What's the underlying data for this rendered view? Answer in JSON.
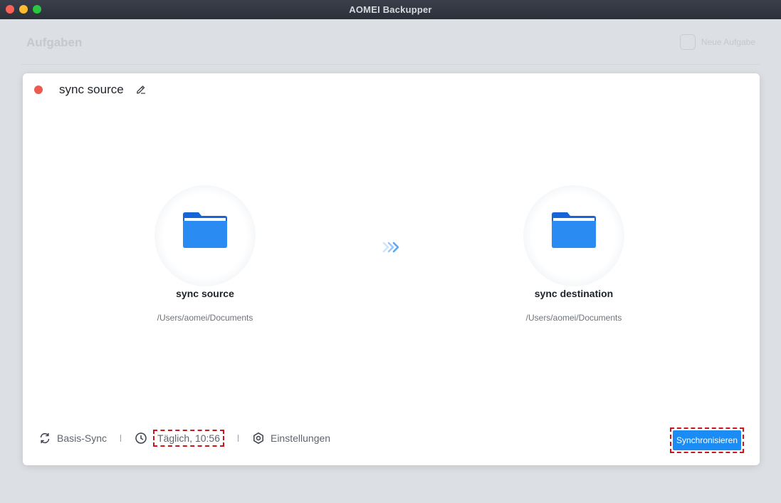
{
  "window": {
    "title": "AOMEI Backupper",
    "traffic_lights": {
      "close_color": "#fe5f57",
      "minimize_color": "#febc2e",
      "maximize_color": "#28c840"
    }
  },
  "background": {
    "heading": "Aufgaben",
    "new_task_label": "Neue Aufgabe"
  },
  "task": {
    "status_color": "#ec5b4f",
    "title": "sync source",
    "edit_icon": "pencil-icon"
  },
  "source": {
    "name": "sync source",
    "path": "/Users/aomei/Documents",
    "icon": "folder-icon"
  },
  "destination": {
    "name": "sync destination",
    "path": "/Users/aomei/Documents",
    "icon": "folder-icon"
  },
  "footer": {
    "sync_mode_icon": "sync-arrows-icon",
    "sync_mode_label": "Basis-Sync",
    "schedule_icon": "clock-icon",
    "schedule_label": "Täglich, 10:56",
    "settings_icon": "gear-icon",
    "settings_label": "Einstellungen"
  },
  "actions": {
    "sync_button_label": "Synchronisieren",
    "accent_color": "#1c8cf5"
  }
}
